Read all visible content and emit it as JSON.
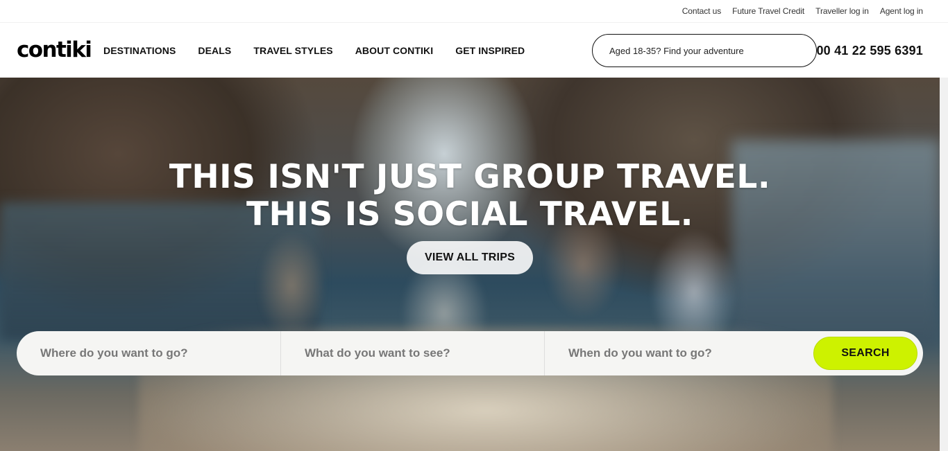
{
  "utility": {
    "contact": "Contact us",
    "future_credit": "Future Travel Credit",
    "traveller_login": "Traveller log in",
    "agent_login": "Agent log in"
  },
  "nav": {
    "logo": "contiki",
    "links": [
      "DESTINATIONS",
      "DEALS",
      "TRAVEL STYLES",
      "ABOUT CONTIKI",
      "GET INSPIRED"
    ],
    "adventure_placeholder": "Aged 18-35? Find your adventure",
    "phone": "00 41 22 595 6391"
  },
  "hero": {
    "line1": "THIS ISN'T JUST GROUP TRAVEL.",
    "line2": "THIS IS SOCIAL TRAVEL.",
    "view_all": "VIEW ALL TRIPS"
  },
  "search": {
    "where": "Where do you want to go?",
    "what": "What do you want to see?",
    "when": "When do you want to go?",
    "button": "SEARCH"
  },
  "colors": {
    "accent": "#cdf200",
    "text": "#111111"
  }
}
